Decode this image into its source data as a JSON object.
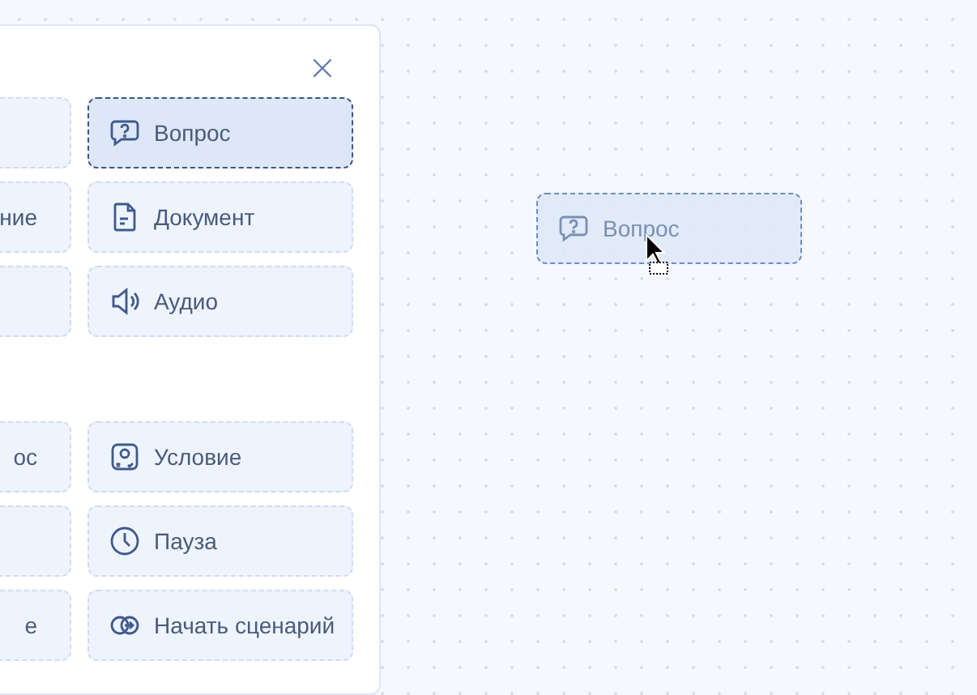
{
  "panel": {
    "close": "×",
    "groups": [
      {
        "left": [
          {
            "selected": false
          },
          {
            "label": "ние",
            "selected": false
          },
          {
            "selected": false
          }
        ],
        "right": [
          {
            "label": "Вопрос",
            "kind": "question",
            "selected": true
          },
          {
            "label": "Документ",
            "kind": "document",
            "selected": false
          },
          {
            "label": "Аудио",
            "kind": "audio",
            "selected": false
          }
        ]
      },
      {
        "left": [
          {
            "label": "ос",
            "selected": false
          },
          {
            "selected": false
          },
          {
            "label": "е",
            "selected": false
          }
        ],
        "right": [
          {
            "label": "Условие",
            "kind": "condition",
            "selected": false
          },
          {
            "label": "Пауза",
            "kind": "clock",
            "selected": false
          },
          {
            "label": "Начать сценарий",
            "kind": "start",
            "selected": false
          }
        ]
      }
    ]
  },
  "drag_ghost": {
    "label": "Вопрос",
    "kind": "question"
  }
}
